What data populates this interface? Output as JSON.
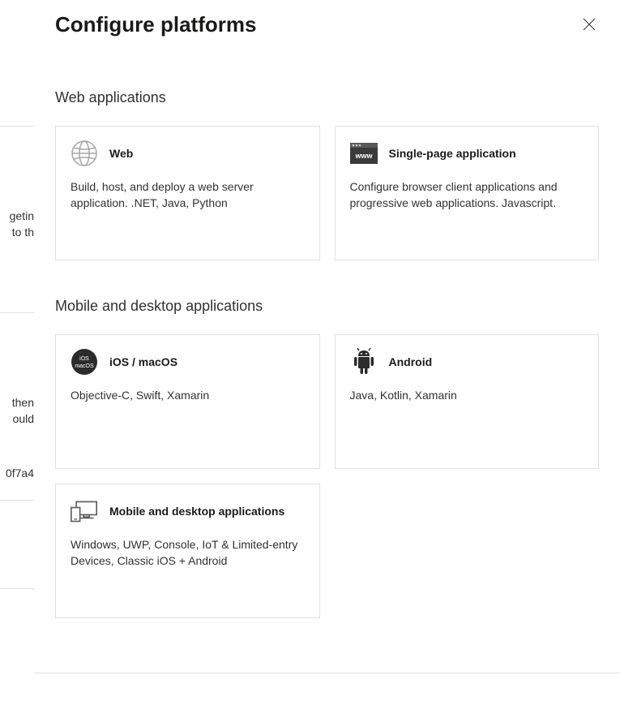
{
  "panel": {
    "title": "Configure platforms"
  },
  "sections": {
    "web": {
      "title": "Web applications",
      "cards": {
        "web": {
          "label": "Web",
          "description": "Build, host, and deploy a web server application. .NET, Java, Python"
        },
        "spa": {
          "label": "Single-page application",
          "description": "Configure browser client applications and progressive web applications. Javascript."
        }
      }
    },
    "mobile": {
      "title": "Mobile and desktop applications",
      "cards": {
        "ios": {
          "label": "iOS / macOS",
          "description": "Objective-C, Swift, Xamarin"
        },
        "android": {
          "label": "Android",
          "description": "Java, Kotlin, Xamarin"
        },
        "desktop": {
          "label": "Mobile and desktop applications",
          "description": "Windows, UWP, Console, IoT & Limited-entry Devices, Classic iOS + Android"
        }
      }
    }
  },
  "background": {
    "text1": "getin",
    "text2": "to th",
    "text3": "then",
    "text4": "ould",
    "text5": "0f7a4"
  }
}
